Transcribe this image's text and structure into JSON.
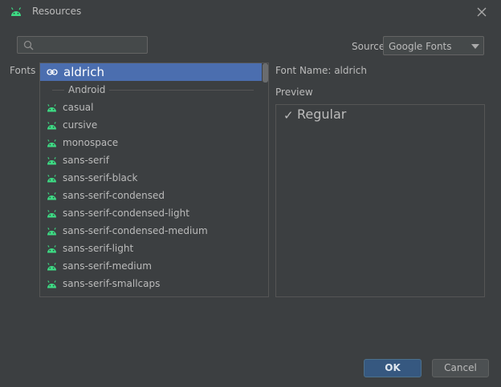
{
  "window": {
    "title": "Resources",
    "app_icon": "android-icon",
    "close_icon": "close-icon"
  },
  "search": {
    "value": "",
    "placeholder": "",
    "icon": "search-icon"
  },
  "source": {
    "label": "Source",
    "selected": "Google Fonts"
  },
  "fonts": {
    "label": "Fonts",
    "selected": {
      "label": "aldrich",
      "icon": "link-icon"
    },
    "group": "Android",
    "items": [
      {
        "label": "casual",
        "icon": "android-icon"
      },
      {
        "label": "cursive",
        "icon": "android-icon"
      },
      {
        "label": "monospace",
        "icon": "android-icon"
      },
      {
        "label": "sans-serif",
        "icon": "android-icon"
      },
      {
        "label": "sans-serif-black",
        "icon": "android-icon"
      },
      {
        "label": "sans-serif-condensed",
        "icon": "android-icon"
      },
      {
        "label": "sans-serif-condensed-light",
        "icon": "android-icon"
      },
      {
        "label": "sans-serif-condensed-medium",
        "icon": "android-icon"
      },
      {
        "label": "sans-serif-light",
        "icon": "android-icon"
      },
      {
        "label": "sans-serif-medium",
        "icon": "android-icon"
      },
      {
        "label": "sans-serif-smallcaps",
        "icon": "android-icon"
      }
    ]
  },
  "details": {
    "font_name": "Font Name: aldrich",
    "preview_label": "Preview",
    "preview_check": "✓",
    "preview_text": "Regular"
  },
  "buttons": {
    "ok": "OK",
    "cancel": "Cancel"
  },
  "colors": {
    "background": "#3c3f41",
    "selection": "#4b6eaf",
    "android_green": "#3ddc84",
    "ok_button": "#365880"
  }
}
